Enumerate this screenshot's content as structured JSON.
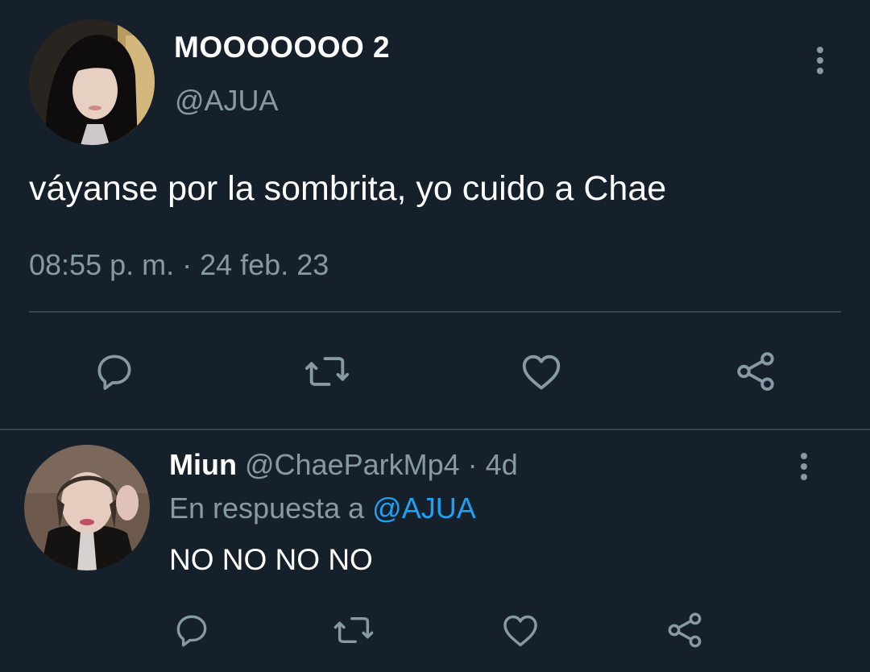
{
  "main_tweet": {
    "author": {
      "display_name": "MOOOOOOO 2",
      "handle": "@AJUA"
    },
    "text": "váyanse por la sombrita, yo cuido a Chae",
    "timestamp": "08:55 p. m. · 24 feb. 23",
    "actions": [
      "reply-icon",
      "retweet-icon",
      "like-icon",
      "share-icon"
    ]
  },
  "reply": {
    "author": {
      "display_name": "Miun",
      "handle": "@ChaeParkMp4",
      "separator": " · ",
      "age": "4d"
    },
    "context_prefix": "En respuesta a ",
    "context_mention": "@AJUA",
    "text": "NO NO NO NO",
    "actions": [
      "reply-icon",
      "retweet-icon",
      "like-icon",
      "share-icon"
    ]
  },
  "colors": {
    "background": "#15202b",
    "primary_text": "#ffffff",
    "secondary_text": "#8899a6",
    "divider": "#38444d",
    "accent": "#1da1f2"
  }
}
